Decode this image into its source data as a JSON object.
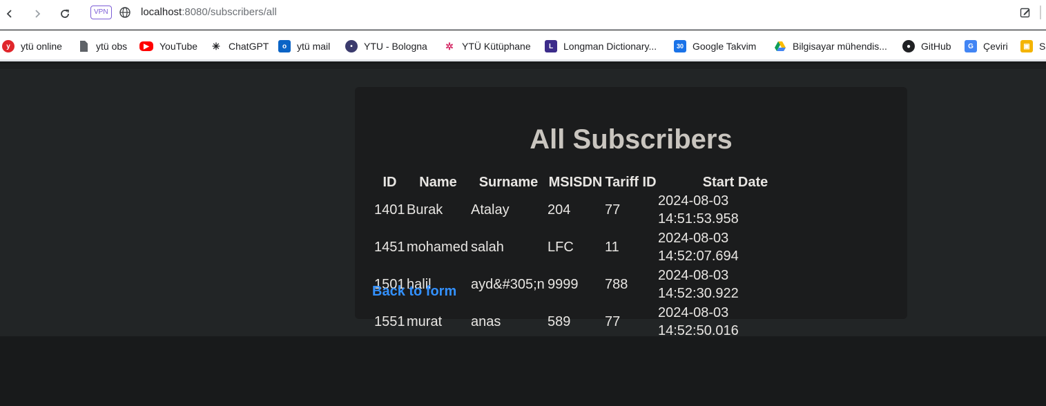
{
  "browser": {
    "vpn_badge": "VPN",
    "url_host": "localhost",
    "url_path": ":8080/subscribers/all",
    "bookmarks": [
      {
        "label": "ytü online",
        "icon": "ytu-online-icon"
      },
      {
        "label": "ytü obs",
        "icon": "document-icon"
      },
      {
        "label": "YouTube",
        "icon": "youtube-icon"
      },
      {
        "label": "ChatGPT",
        "icon": "chatgpt-icon"
      },
      {
        "label": "ytü mail",
        "icon": "outlook-icon"
      },
      {
        "label": "YTU - Bologna",
        "icon": "ytu-seal-icon"
      },
      {
        "label": "YTÜ Kütüphane",
        "icon": "library-icon"
      },
      {
        "label": "Longman Dictionary...",
        "icon": "longman-icon"
      },
      {
        "label": "Google Takvim",
        "icon": "calendar-icon"
      },
      {
        "label": "Bilgisayar mühendis...",
        "icon": "drive-icon"
      },
      {
        "label": "GitHub",
        "icon": "github-icon"
      },
      {
        "label": "Çeviri",
        "icon": "translate-icon"
      },
      {
        "label": "Sı",
        "icon": "classroom-icon"
      }
    ]
  },
  "page": {
    "title": "All Subscribers",
    "back_link": "Back to form"
  },
  "table": {
    "headers": [
      "ID",
      "Name",
      "Surname",
      "MSISDN",
      "Tariff ID",
      "Start Date"
    ],
    "rows": [
      [
        "1401",
        "Burak",
        "Atalay",
        "204",
        "77",
        "2024-08-03 14:51:53.958"
      ],
      [
        "1451",
        "mohamed",
        "salah",
        "LFC",
        "11",
        "2024-08-03 14:52:07.694"
      ],
      [
        "1501",
        "halil",
        "ayd&#305;n",
        "9999",
        "788",
        "2024-08-03 14:52:30.922"
      ],
      [
        "1551",
        "murat",
        "anas",
        "589",
        "77",
        "2024-08-03 14:52:50.016"
      ]
    ]
  },
  "colors": {
    "page_background": "#181a1b",
    "card_background": "#1b1c1d",
    "title_color": "#c9c5bf",
    "link_color": "#3391ff"
  }
}
